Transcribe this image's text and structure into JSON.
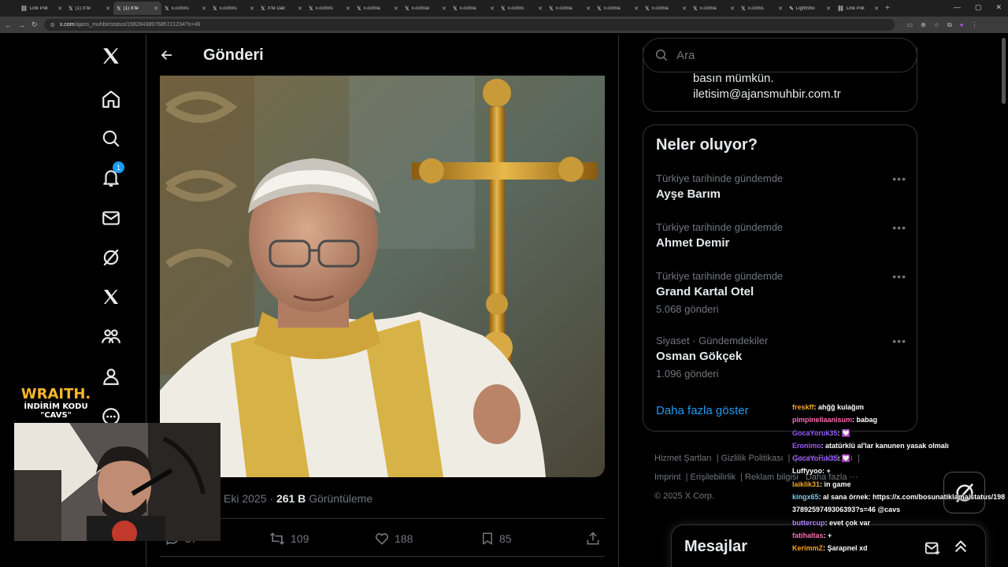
{
  "browser": {
    "tabs": [
      {
        "icon": "link-icon",
        "label": "Link Poli"
      },
      {
        "icon": "x-logo-icon",
        "label": "(1) X'te"
      },
      {
        "icon": "x-logo-icon",
        "label": "(1) X'te"
      },
      {
        "icon": "x-logo-icon",
        "label": "x.com/is"
      },
      {
        "icon": "x-logo-icon",
        "label": "x.com/is"
      },
      {
        "icon": "x-logo-icon",
        "label": "X'te Dali"
      },
      {
        "icon": "x-logo-icon",
        "label": "x.com/is"
      },
      {
        "icon": "x-logo-icon",
        "label": "x.com/a"
      },
      {
        "icon": "x-logo-icon",
        "label": "x.com/al"
      },
      {
        "icon": "x-logo-icon",
        "label": "x.com/a"
      },
      {
        "icon": "x-logo-icon",
        "label": "x.com/s"
      },
      {
        "icon": "x-logo-icon",
        "label": "x.com/a"
      },
      {
        "icon": "x-logo-icon",
        "label": "x.com/a"
      },
      {
        "icon": "x-logo-icon",
        "label": "x.com/a"
      },
      {
        "icon": "x-logo-icon",
        "label": "x.com/a"
      },
      {
        "icon": "x-logo-icon",
        "label": "x.com/L"
      },
      {
        "icon": "lightshot-icon",
        "label": "LightSho"
      },
      {
        "icon": "link-icon",
        "label": "Link Poli"
      }
    ],
    "url_host": "x.com",
    "url_path": "/ajans_muhbir/status/1982843897685721234?s=46"
  },
  "nav": {
    "notification_count": "1"
  },
  "header": {
    "title": "Gönderi"
  },
  "post": {
    "date_partial": "Eki 2025",
    "views": "261 B",
    "views_label": "Görüntüleme",
    "reply_count": "57",
    "repost_count": "109",
    "like_count": "188",
    "bookmark_count": "85"
  },
  "sidebar": {
    "search_placeholder": "Ara",
    "profile_card": {
      "line1": "basın mümkün.",
      "line2": "iletisim@ajansmuhbir.com.tr"
    },
    "trends_title": "Neler oluyor?",
    "trends": [
      {
        "context": "Türkiye tarihinde gündemde",
        "name": "Ayşe Barım",
        "count": ""
      },
      {
        "context": "Türkiye tarihinde gündemde",
        "name": "Ahmet Demir",
        "count": ""
      },
      {
        "context": "Türkiye tarihinde gündemde",
        "name": "Grand Kartal Otel",
        "count": "5.068 gönderi"
      },
      {
        "context": "Siyaset · Gündemdekiler",
        "name": "Osman Gökçek",
        "count": "1.096 gönderi"
      }
    ],
    "show_more": "Daha fazla göster",
    "footer": {
      "terms": "Hizmet Şartları",
      "privacy": "Gizlilik Politikası",
      "cookies": "Çerez Politikası",
      "imprint": "Imprint",
      "accessibility": "Erişilebilirlik",
      "ads": "Reklam bilgisi",
      "more": "Daha fazla ···",
      "copyright": "© 2025 X Corp."
    },
    "messages_title": "Mesajlar"
  },
  "overlay": {
    "sponsor_line1": "WRAITH.",
    "sponsor_line2": "İNDİRİM KODU",
    "sponsor_line3": "\"CAVS\"",
    "chat": [
      {
        "user": "freskff",
        "color": "#f5a623",
        "text": ": ahğğ kulağım"
      },
      {
        "user": "pimpinellaanisum",
        "color": "#ff69b4",
        "text": ": babag"
      },
      {
        "user": "GocaYoruk35",
        "color": "#9b59ff",
        "text": ": 💟"
      },
      {
        "user": "Eronimo",
        "color": "#9b59ff",
        "text": ": atatürklü al'lar kanunen yasak olmalı"
      },
      {
        "user": "GocaYoruk35",
        "color": "#9b59ff",
        "text": ": 💟"
      },
      {
        "user": "Luffyyoo",
        "color": "#ffffff",
        "text": ": +"
      },
      {
        "user": "laiklik31",
        "color": "#f5a623",
        "text": ": in game"
      },
      {
        "user": "kingx65",
        "color": "#7ec8e3",
        "text": ": al sana örnek: https://x.com/bosunatiklama/status/1983789259749306393?s=46 @cavs"
      },
      {
        "user": "buttercup",
        "color": "#b388ff",
        "text": ": evet çok var"
      },
      {
        "user": "fatihaltas",
        "color": "#ff69b4",
        "text": ": +"
      },
      {
        "user": "KerimmZ",
        "color": "#f5a623",
        "text": ": Şarapnel xd"
      }
    ]
  }
}
